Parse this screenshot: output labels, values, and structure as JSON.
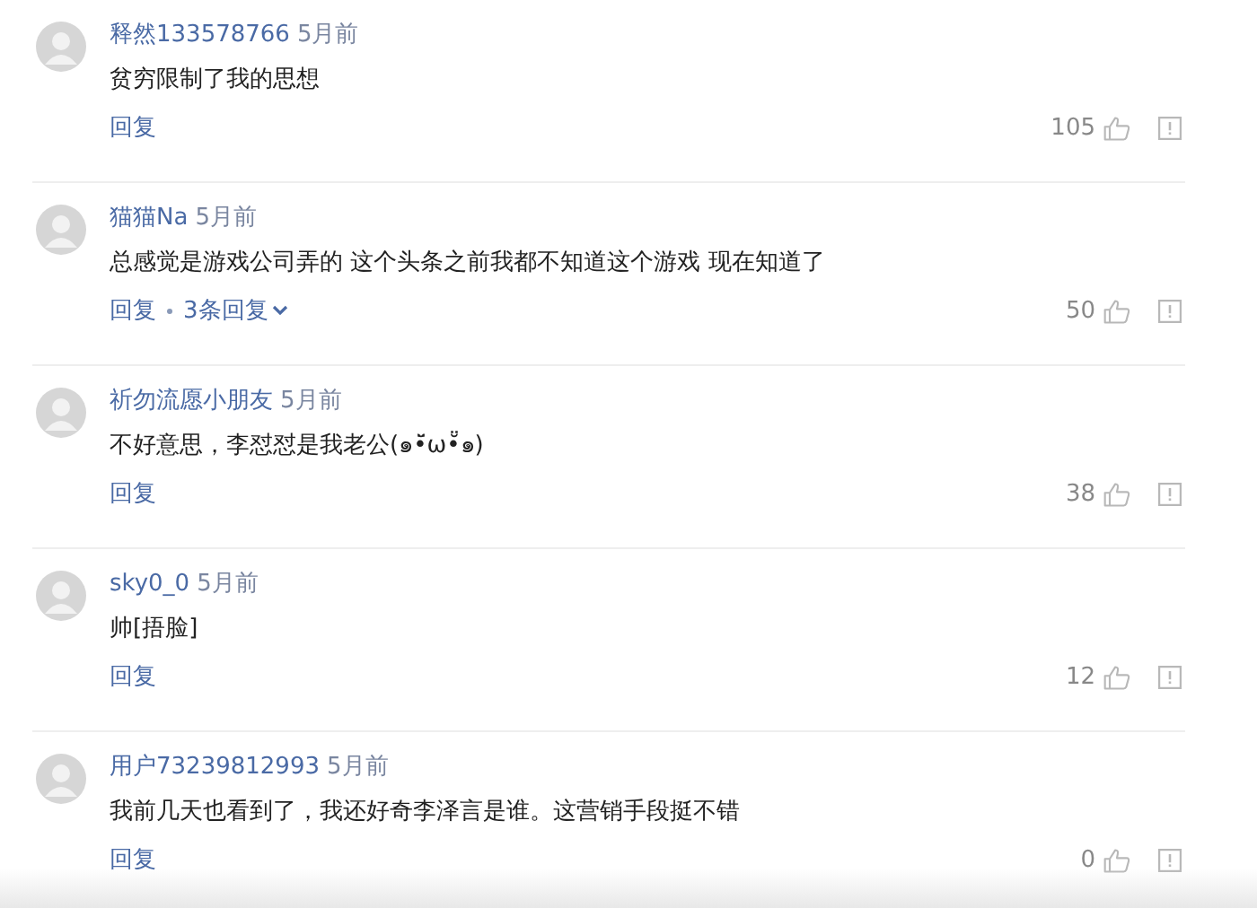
{
  "comments": [
    {
      "user": "释然133578766",
      "time": "5月前",
      "text": "贫穷限制了我的思想",
      "reply": "回复",
      "likes": "105"
    },
    {
      "user": "猫猫Na",
      "time": "5月前",
      "text": "总感觉是游戏公司弄的 这个头条之前我都不知道这个游戏 现在知道了",
      "reply": "回复",
      "replies_link": "3条回复",
      "likes": "50"
    },
    {
      "user": "祈勿流愿小朋友",
      "time": "5月前",
      "text": "不好意思，李怼怼是我老公(๑•̆̈ω•̆̈๑)",
      "reply": "回复",
      "likes": "38"
    },
    {
      "user": "sky0_0",
      "time": "5月前",
      "text": "帅[捂脸]",
      "reply": "回复",
      "likes": "12"
    },
    {
      "user": "用户73239812993",
      "time": "5月前",
      "text": "我前几天也看到了，我还好奇李泽言是谁。这营销手段挺不错",
      "reply": "回复",
      "likes": "0"
    }
  ]
}
